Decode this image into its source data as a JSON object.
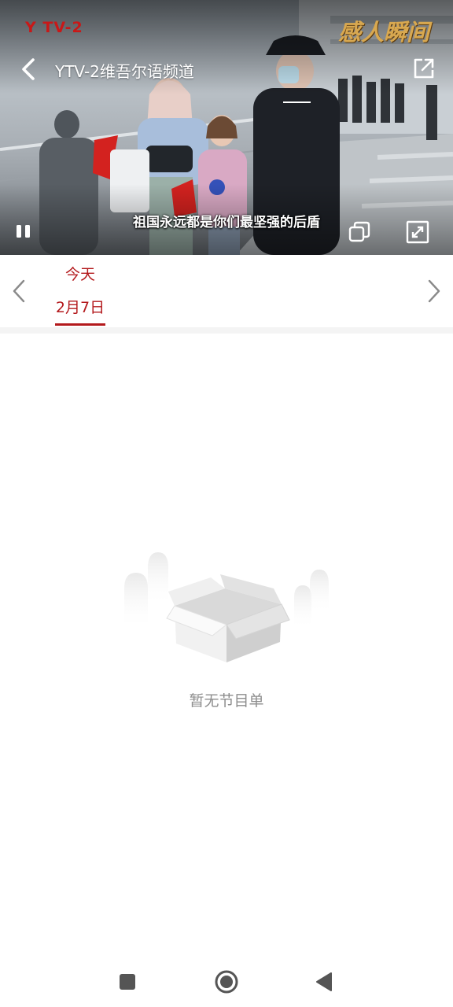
{
  "player": {
    "logo_text": "Y TV-2",
    "watermark_text": "感人瞬间",
    "channel_title": "YTV-2维吾尔语频道",
    "subtitle": "祖国永远都是你们最坚强的后盾",
    "icons": {
      "back": "chevron-left-icon",
      "share": "external-link-icon",
      "pause": "pause-icon",
      "pip": "picture-in-picture-icon",
      "fullscreen": "fullscreen-icon"
    }
  },
  "date_selector": {
    "selected": {
      "day_label": "今天",
      "date_label": "2月7日"
    },
    "accent_color": "#b3191c",
    "icons": {
      "prev": "chevron-left-icon",
      "next": "chevron-right-icon"
    }
  },
  "empty_state": {
    "message": "暂无节目单",
    "icon": "empty-box-icon"
  },
  "system_nav": {
    "icons": {
      "recent": "square-icon",
      "home": "circle-icon",
      "back": "triangle-back-icon"
    }
  }
}
